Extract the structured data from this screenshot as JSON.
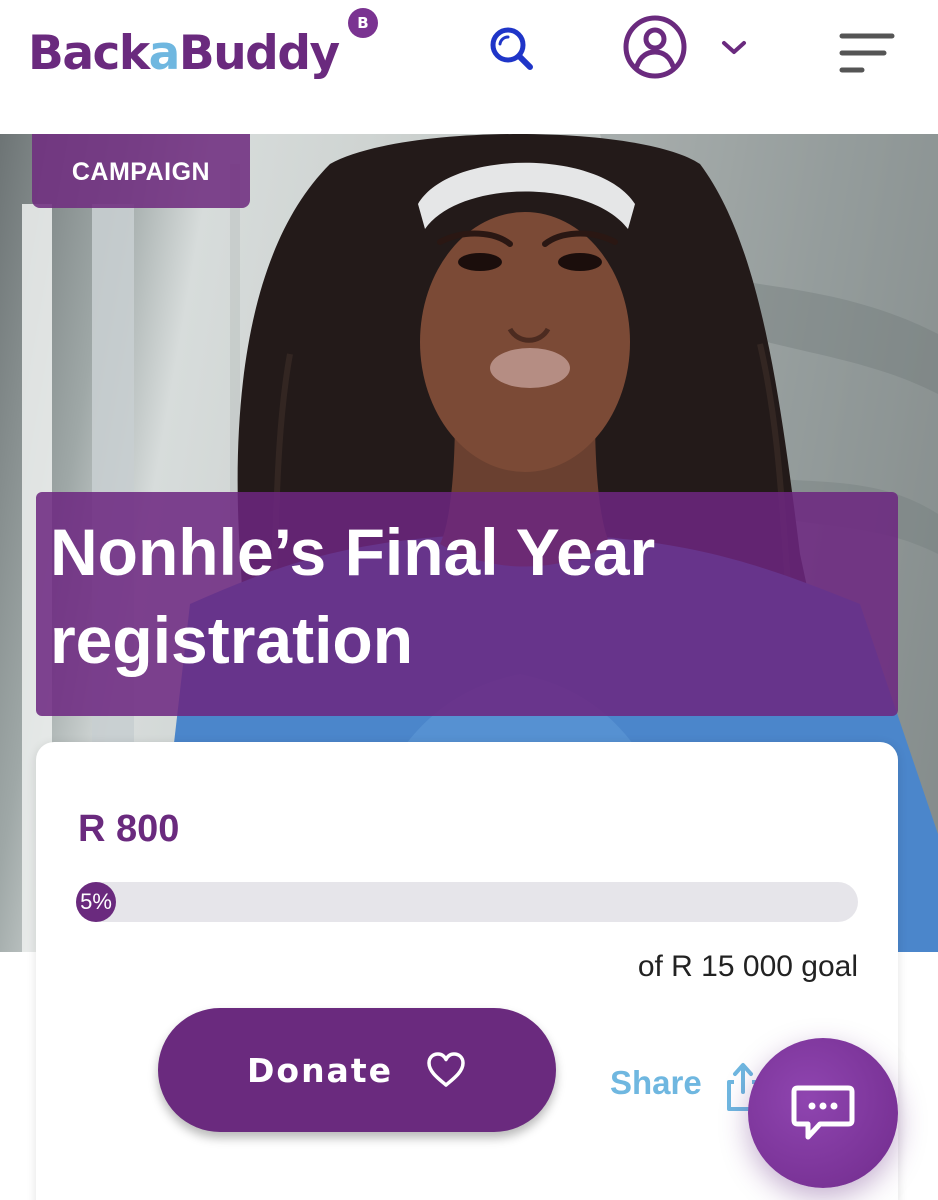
{
  "header": {
    "logo": {
      "text_back": "Back",
      "text_a": "a",
      "text_buddy": "Buddy",
      "badge": "B"
    },
    "icons": {
      "search": "search-icon",
      "account": "user-icon",
      "account_menu": "chevron-down-icon",
      "menu": "menu-icon"
    }
  },
  "hero": {
    "badge": "CAMPAIGN",
    "title_line1": "Nonhle’s Final Year",
    "title_line2": "registration"
  },
  "card": {
    "raised": "R 800",
    "progress_label": "5%",
    "progress_fraction": 0.05,
    "goal": "of R 15 000 goal",
    "donate_label": "Donate",
    "share_label": "Share"
  },
  "chat": {
    "icon": "chat-icon"
  },
  "colors": {
    "brand_purple": "#6a2a7e",
    "accent_blue": "#6fb7e0",
    "track_grey": "#e6e5ea"
  }
}
